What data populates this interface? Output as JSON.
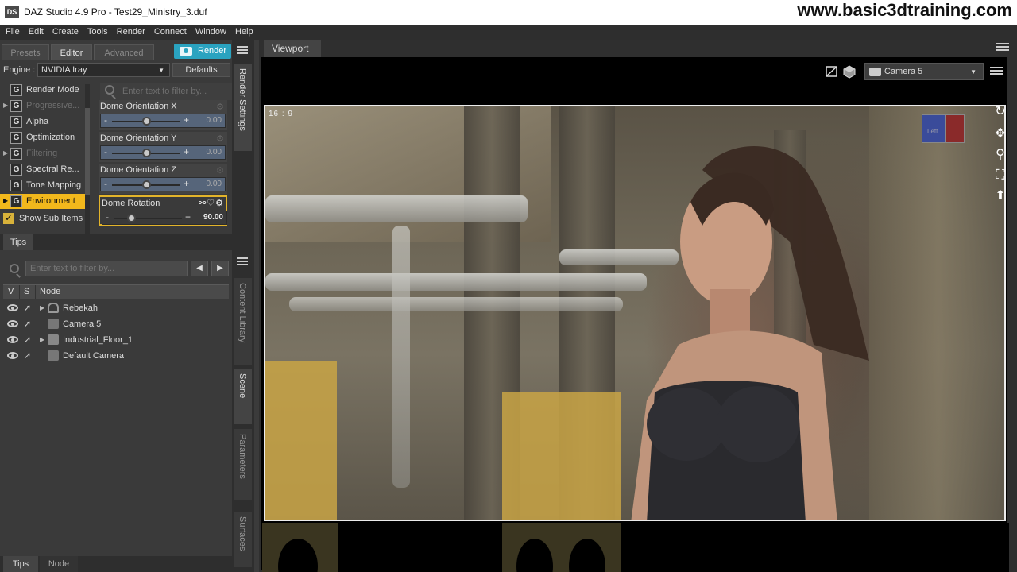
{
  "window": {
    "title": "DAZ Studio 4.9 Pro - Test29_Ministry_3.duf",
    "app_icon_text": "DS",
    "watermark": "www.basic3dtraining.com"
  },
  "menu": [
    "File",
    "Edit",
    "Create",
    "Tools",
    "Render",
    "Connect",
    "Window",
    "Help"
  ],
  "render_settings": {
    "tabs": [
      "Presets",
      "Editor",
      "Advanced"
    ],
    "active_tab": "Editor",
    "render_button": "Render",
    "engine_label": "Engine :",
    "engine_value": "NVIDIA Iray",
    "defaults_button": "Defaults",
    "filter_placeholder": "Enter text to filter by...",
    "tree": [
      {
        "label": "Render Mode",
        "expandable": false,
        "dim": false
      },
      {
        "label": "Progressive...",
        "expandable": true,
        "dim": true
      },
      {
        "label": "Alpha",
        "expandable": false,
        "dim": false
      },
      {
        "label": "Optimization",
        "expandable": false,
        "dim": false
      },
      {
        "label": "Filtering",
        "expandable": true,
        "dim": true
      },
      {
        "label": "Spectral Re...",
        "expandable": false,
        "dim": false
      },
      {
        "label": "Tone Mapping",
        "expandable": false,
        "dim": false
      },
      {
        "label": "Environment",
        "expandable": true,
        "dim": false,
        "selected": true
      }
    ],
    "show_sub_items": "Show Sub Items",
    "properties": [
      {
        "name": "Dome Orientation X",
        "value": "0.00",
        "level": 0.5
      },
      {
        "name": "Dome Orientation Y",
        "value": "0.00",
        "level": 0.5
      },
      {
        "name": "Dome Orientation Z",
        "value": "0.00",
        "level": 0.5
      },
      {
        "name": "Dome Rotation",
        "value": "90.00",
        "level": 0.25,
        "highlighted": true
      }
    ],
    "side_tab": "Render Settings"
  },
  "tips_tab": "Tips",
  "scene": {
    "filter_placeholder": "Enter text to filter by...",
    "columns": [
      "V",
      "S",
      "Node"
    ],
    "nodes": [
      {
        "name": "Rebekah",
        "icon": "figure-icon",
        "expandable": true
      },
      {
        "name": "Camera 5",
        "icon": "camera-icon",
        "expandable": false
      },
      {
        "name": "Industrial_Floor_1",
        "icon": "prop-icon",
        "expandable": true
      },
      {
        "name": "Default Camera",
        "icon": "camera-icon",
        "expandable": false
      }
    ],
    "side_tabs": [
      "Content Library",
      "Scene",
      "Parameters",
      "Surfaces"
    ],
    "bottom_tabs": [
      "Tips",
      "Node"
    ]
  },
  "viewport": {
    "tab": "Viewport",
    "camera": "Camera 5",
    "aspect": "16 : 9",
    "nav_cube_label": "Left"
  }
}
